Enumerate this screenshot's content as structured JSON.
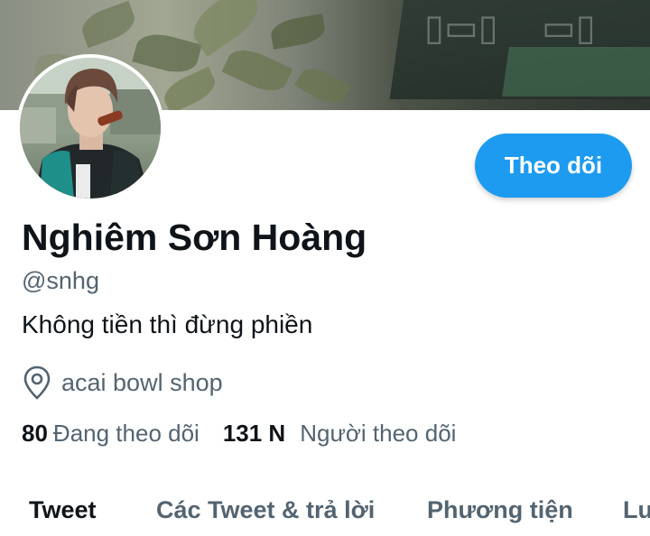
{
  "profile": {
    "display_name": "Nghiêm Sơn Hoàng",
    "handle": "@snhg",
    "bio": "Không tiền thì đừng phiền",
    "location": "acai bowl shop",
    "location_icon": "location-pin-icon"
  },
  "actions": {
    "follow_label": "Theo dõi"
  },
  "stats": {
    "following_count": "80",
    "following_label": "Đang theo dõi",
    "followers_count": "131 N",
    "followers_label": "Người theo dõi"
  },
  "tabs": [
    {
      "label": "Tweet",
      "active": true
    },
    {
      "label": "Các Tweet & trả lời",
      "active": false
    },
    {
      "label": "Phương tiện",
      "active": false
    },
    {
      "label": "Lư",
      "active": false
    }
  ],
  "colors": {
    "accent": "#1d9bf0",
    "primary_text": "#0f1419",
    "secondary_text": "#536471"
  }
}
